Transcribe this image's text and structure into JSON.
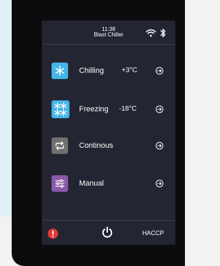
{
  "status_bar": {
    "time": "11:38",
    "device_name": "Blast Chiller",
    "icons": [
      "wifi-icon",
      "bluetooth-icon"
    ]
  },
  "modes": [
    {
      "label": "Chilling",
      "value": "+3°C",
      "icon": "snowflake-icon",
      "color": "#44b5e8"
    },
    {
      "label": "Freezing",
      "value": "-18°C",
      "icon": "double-snowflake-icon",
      "color": "#44b5e8"
    },
    {
      "label": "Continous",
      "value": "",
      "icon": "cycle-arrows-icon",
      "color": "#707070"
    },
    {
      "label": "Manual",
      "value": "",
      "icon": "sliders-icon",
      "color": "#8a5aa8"
    }
  ],
  "bottom_bar": {
    "alarm_icon": "alarm-icon",
    "alarm_color": "#e23a3a",
    "power_icon": "power-icon",
    "haccp_label": "HACCP"
  },
  "colors": {
    "screen_background": "#232632",
    "device_bezel": "#0c0c0e",
    "page_background_top": "#dff0f8"
  }
}
